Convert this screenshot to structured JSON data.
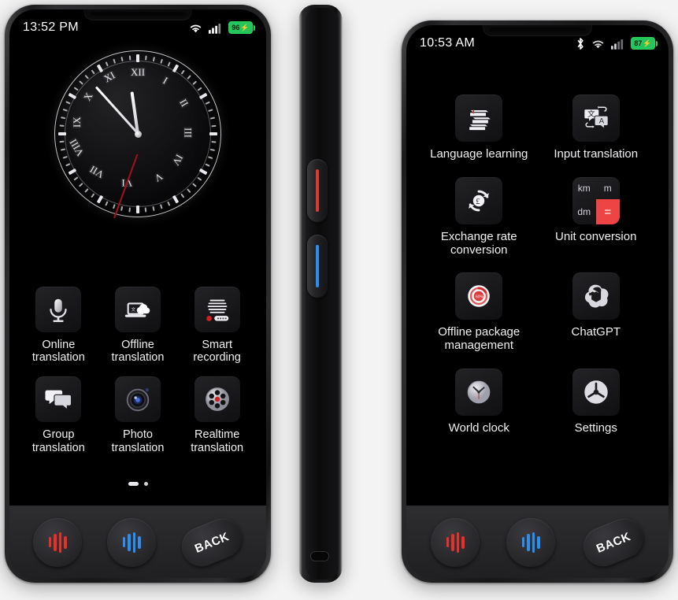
{
  "background_color": "#f3f3f3",
  "left_phone": {
    "name": "translator-device-front-home",
    "status_bar": {
      "time": "13:52 PM",
      "wifi_icon": "wifi-icon",
      "signal_icon": "cellular-signal-icon",
      "battery_level": "96",
      "battery_charging_icon": "charging-bolt-icon",
      "battery_color": "#22c55e"
    },
    "clock_widget": {
      "name": "analog-clock-widget",
      "numerals": [
        "XII",
        "I",
        "II",
        "III",
        "IV",
        "V",
        "VI",
        "VII",
        "VIII",
        "IX",
        "X",
        "XI"
      ],
      "hour_hand_deg": 352,
      "minute_hand_deg": 318,
      "second_hand_deg": 200,
      "second_hand_color": "#a51020"
    },
    "apps": [
      {
        "icon": "microphone-icon",
        "label": "Online\ntranslation"
      },
      {
        "icon": "laptop-cloud-icon",
        "label": "Offline\ntranslation"
      },
      {
        "icon": "voice-recorder-icon",
        "label": "Smart\nrecording"
      },
      {
        "icon": "speech-bubbles-icon",
        "label": "Group\ntranslation"
      },
      {
        "icon": "camera-lens-icon",
        "label": "Photo\ntranslation"
      },
      {
        "icon": "disc-recorder-icon",
        "label": "Realtime\ntranslation"
      }
    ],
    "page_dots": {
      "count": 2,
      "active_index": 0
    },
    "hardware_buttons": [
      {
        "name": "red-voice-button",
        "icon": "waveform-icon",
        "color": "#e8302a"
      },
      {
        "name": "blue-voice-button",
        "icon": "waveform-icon",
        "color": "#2b8ef0"
      },
      {
        "name": "back-button",
        "label": "BACK"
      }
    ]
  },
  "side_phone": {
    "name": "translator-device-side-profile",
    "buttons": [
      {
        "name": "red-side-button",
        "color": "#d93b2f"
      },
      {
        "name": "blue-side-button",
        "color": "#2b8ef0"
      }
    ],
    "port": "usb-c-port"
  },
  "right_phone": {
    "name": "translator-device-front-apps-page-2",
    "status_bar": {
      "time": "10:53 AM",
      "bluetooth_icon": "bluetooth-icon",
      "wifi_icon": "wifi-icon",
      "signal_icon": "cellular-signal-icon",
      "battery_level": "87",
      "battery_charging_icon": "charging-bolt-icon",
      "battery_color": "#22c55e"
    },
    "apps": [
      {
        "icon": "books-stack-icon",
        "label": "Language learning"
      },
      {
        "icon": "translate-bubbles-icon",
        "label": "Input translation"
      },
      {
        "icon": "currency-exchange-icon",
        "label": "Exchange rate\nconversion"
      },
      {
        "icon": "unit-grid-icon",
        "label": "Unit conversion",
        "cells": [
          "km",
          "m",
          "dm",
          "="
        ],
        "accent": "#ef4444"
      },
      {
        "icon": "offline-package-icon",
        "label": "Offline package\nmanagement"
      },
      {
        "icon": "chatgpt-logo-icon",
        "label": "ChatGPT"
      },
      {
        "icon": "world-clock-icon",
        "label": "World clock"
      },
      {
        "icon": "gear-icon",
        "label": "Settings"
      }
    ],
    "page_dots": {
      "count": 2,
      "active_index": 1
    },
    "hardware_buttons": [
      {
        "name": "red-voice-button",
        "icon": "waveform-icon",
        "color": "#e8302a"
      },
      {
        "name": "blue-voice-button",
        "icon": "waveform-icon",
        "color": "#2b8ef0"
      },
      {
        "name": "back-button",
        "label": "BACK"
      }
    ]
  }
}
